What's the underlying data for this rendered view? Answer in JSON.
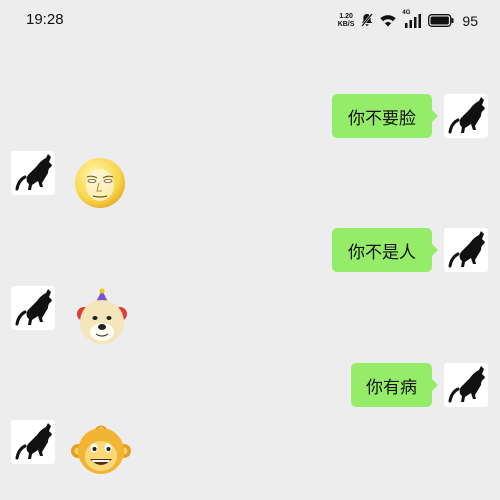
{
  "status_bar": {
    "time": "19:28",
    "net_speed_value": "1.20",
    "net_speed_unit": "KB/S",
    "network_type": "4G",
    "battery_level": "95"
  },
  "messages": [
    {
      "direction": "sent",
      "type": "text",
      "text": "你不要脸"
    },
    {
      "direction": "received",
      "type": "sticker",
      "sticker": "pale-moon-face-emoji"
    },
    {
      "direction": "sent",
      "type": "text",
      "text": "你不是人"
    },
    {
      "direction": "received",
      "type": "sticker",
      "sticker": "doge-clown-emoji"
    },
    {
      "direction": "sent",
      "type": "text",
      "text": "你有病"
    },
    {
      "direction": "received",
      "type": "sticker",
      "sticker": "grinning-monkey-emoji"
    }
  ],
  "avatar": {
    "icon": "black-cat-avatar-icon"
  },
  "colors": {
    "background": "#ededed",
    "sent_bubble": "#95ec69",
    "text": "#111111"
  }
}
